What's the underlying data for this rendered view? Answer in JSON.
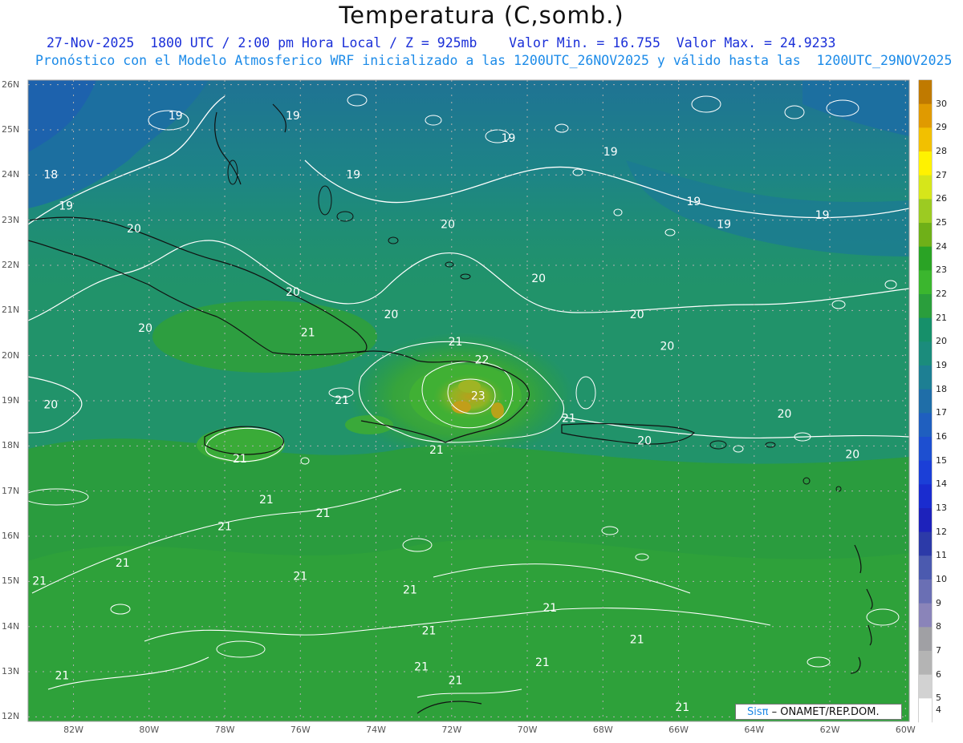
{
  "title": "Temperatura (C,somb.)",
  "subtitle_line1": "27-Nov-2025  1800 UTC / 2:00 pm Hora Local / Z = 925mb    Valor Min. = 16.755  Valor Max. = 24.9233",
  "subtitle_line2": "Pronóstico con el Modelo Atmosferico WRF inicializado a las 1200UTC_26NOV2025 y válido hasta las  1200UTC_29NOV2025",
  "credit": {
    "brand": "Sisπ",
    "text": " – ONAMET/REP.DOM."
  },
  "lat_labels": [
    "26N",
    "25N",
    "24N",
    "23N",
    "22N",
    "21N",
    "20N",
    "19N",
    "18N",
    "17N",
    "16N",
    "15N",
    "14N",
    "13N",
    "12N"
  ],
  "lon_labels": [
    "82W",
    "80W",
    "78W",
    "76W",
    "74W",
    "72W",
    "70W",
    "68W",
    "66W",
    "64W",
    "62W",
    "60W"
  ],
  "colorbar": {
    "labels": [
      "30",
      "29",
      "28",
      "27",
      "26",
      "25",
      "24",
      "23",
      "22",
      "21",
      "20",
      "19",
      "18",
      "17",
      "16",
      "15",
      "14",
      "13",
      "12",
      "11",
      "10",
      "9",
      "8",
      "7",
      "6",
      "5",
      "4"
    ],
    "colors": [
      "#c07a00",
      "#e09a00",
      "#f2c000",
      "#fff200",
      "#d6e61a",
      "#9ccb22",
      "#6fb018",
      "#2aa325",
      "#3bb62e",
      "#2a9e3c",
      "#16906a",
      "#1b8c7c",
      "#1d7f93",
      "#1f6ea8",
      "#1f5fbf",
      "#1d4fd0",
      "#1b3fd7",
      "#1a2ccf",
      "#1d22bb",
      "#2c3aa8",
      "#4b5aaf",
      "#6a6fb4",
      "#8a84b9",
      "#a0a0a4",
      "#b4b4b4",
      "#d2d2d2",
      "#ffffff"
    ]
  },
  "contour_labels": [
    {
      "t": "19",
      "lon": -79.3,
      "lat": 25.3
    },
    {
      "t": "19",
      "lon": -76.2,
      "lat": 25.3
    },
    {
      "t": "18",
      "lon": -82.6,
      "lat": 24.0
    },
    {
      "t": "19",
      "lon": -82.2,
      "lat": 23.3
    },
    {
      "t": "19",
      "lon": -74.6,
      "lat": 24.0
    },
    {
      "t": "19",
      "lon": -70.5,
      "lat": 24.8
    },
    {
      "t": "19",
      "lon": -67.8,
      "lat": 24.5
    },
    {
      "t": "19",
      "lon": -65.6,
      "lat": 23.4
    },
    {
      "t": "19",
      "lon": -64.8,
      "lat": 22.9
    },
    {
      "t": "19",
      "lon": -62.2,
      "lat": 23.1
    },
    {
      "t": "20",
      "lon": -80.4,
      "lat": 22.8
    },
    {
      "t": "20",
      "lon": -72.1,
      "lat": 22.9
    },
    {
      "t": "20",
      "lon": -69.7,
      "lat": 21.7
    },
    {
      "t": "20",
      "lon": -67.1,
      "lat": 20.9
    },
    {
      "t": "20",
      "lon": -76.2,
      "lat": 21.4
    },
    {
      "t": "20",
      "lon": -80.1,
      "lat": 20.6
    },
    {
      "t": "20",
      "lon": -73.6,
      "lat": 20.9
    },
    {
      "t": "20",
      "lon": -66.3,
      "lat": 20.2
    },
    {
      "t": "20",
      "lon": -82.6,
      "lat": 18.9
    },
    {
      "t": "20",
      "lon": -63.2,
      "lat": 18.7
    },
    {
      "t": "20",
      "lon": -66.9,
      "lat": 18.1
    },
    {
      "t": "20",
      "lon": -61.4,
      "lat": 17.8
    },
    {
      "t": "21",
      "lon": -75.8,
      "lat": 20.5
    },
    {
      "t": "21",
      "lon": -71.9,
      "lat": 20.3
    },
    {
      "t": "21",
      "lon": -74.9,
      "lat": 19.0
    },
    {
      "t": "21",
      "lon": -68.9,
      "lat": 18.6
    },
    {
      "t": "21",
      "lon": -72.4,
      "lat": 17.9
    },
    {
      "t": "21",
      "lon": -77.6,
      "lat": 17.7
    },
    {
      "t": "21",
      "lon": -76.9,
      "lat": 16.8
    },
    {
      "t": "21",
      "lon": -75.4,
      "lat": 16.5
    },
    {
      "t": "21",
      "lon": -78.0,
      "lat": 16.2
    },
    {
      "t": "21",
      "lon": -80.7,
      "lat": 15.4
    },
    {
      "t": "21",
      "lon": -76.0,
      "lat": 15.1
    },
    {
      "t": "21",
      "lon": -82.9,
      "lat": 15.0
    },
    {
      "t": "21",
      "lon": -73.1,
      "lat": 14.8
    },
    {
      "t": "21",
      "lon": -69.4,
      "lat": 14.4
    },
    {
      "t": "21",
      "lon": -72.6,
      "lat": 13.9
    },
    {
      "t": "21",
      "lon": -67.1,
      "lat": 13.7
    },
    {
      "t": "21",
      "lon": -69.6,
      "lat": 13.2
    },
    {
      "t": "21",
      "lon": -72.8,
      "lat": 13.1
    },
    {
      "t": "21",
      "lon": -82.3,
      "lat": 12.9
    },
    {
      "t": "21",
      "lon": -71.9,
      "lat": 12.8
    },
    {
      "t": "21",
      "lon": -65.9,
      "lat": 12.2
    },
    {
      "t": "22",
      "lon": -71.2,
      "lat": 19.9
    },
    {
      "t": "23",
      "lon": -71.3,
      "lat": 19.1
    }
  ],
  "grid": {
    "lon_min": -83.2,
    "lon_max": -59.9,
    "lat_min": 11.9,
    "lat_max": 26.1,
    "dotted": true
  }
}
